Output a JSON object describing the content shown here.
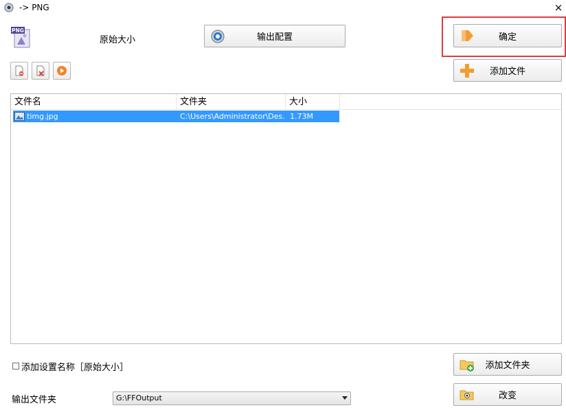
{
  "window": {
    "title": "-> PNG",
    "close_glyph": "×"
  },
  "header": {
    "format_icon_text": "PNG",
    "size_label": "原始大小"
  },
  "buttons": {
    "output_config": "输出配置",
    "ok": "确定",
    "add_file": "添加文件",
    "add_folder": "添加文件夹",
    "change": "改变"
  },
  "toolbar": {
    "icons": [
      "remove-file-icon",
      "clear-list-icon",
      "play-icon"
    ]
  },
  "file_list": {
    "columns": [
      "文件名",
      "文件夹",
      "大小"
    ],
    "rows": [
      {
        "name": "timg.jpg",
        "folder": "C:\\Users\\Administrator\\Des...",
        "size": "1.73M",
        "selected": true
      }
    ]
  },
  "options": {
    "add_setting_name_label": "添加设置名称［原始大小］",
    "add_setting_name_checked": false
  },
  "output": {
    "label": "输出文件夹",
    "folder": "G:\\FFOutput"
  },
  "colors": {
    "selection": "#3399ff",
    "highlight": "#e0393d"
  }
}
